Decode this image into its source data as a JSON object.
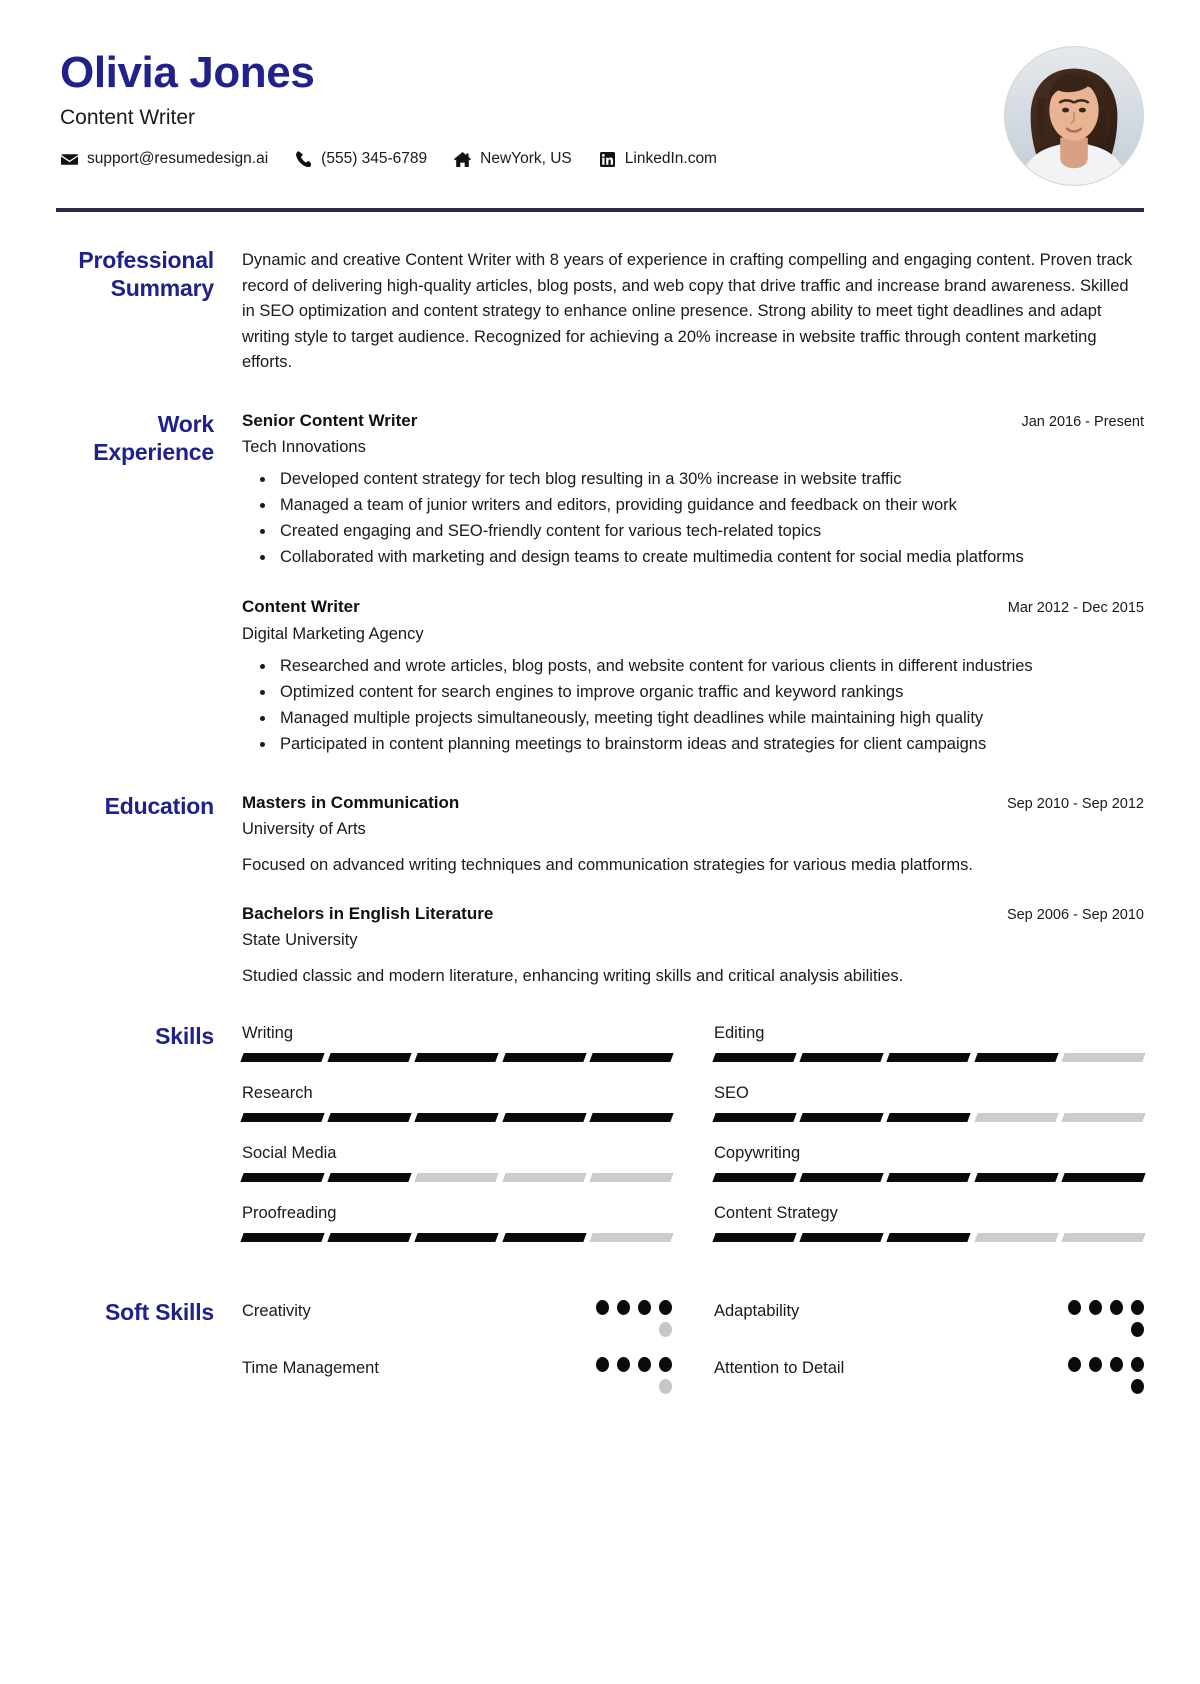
{
  "theme": {
    "accent": "#21218c",
    "rule": "#2b2b44",
    "bar_filled": "#0b0b0b",
    "bar_empty": "#cccccc",
    "dot_filled": "#0b0b0b",
    "dot_empty": "#c6c6c6"
  },
  "header": {
    "name": "Olivia Jones",
    "job_title": "Content Writer",
    "contacts": [
      {
        "icon": "envelope-icon",
        "text": "support@resumedesign.ai"
      },
      {
        "icon": "phone-icon",
        "text": "(555) 345-6789"
      },
      {
        "icon": "home-icon",
        "text": "NewYork, US"
      },
      {
        "icon": "linkedin-icon",
        "text": "LinkedIn.com"
      }
    ],
    "avatar_alt": "profile photo"
  },
  "sections": {
    "summary": {
      "label": "Professional Summary",
      "text": "Dynamic and creative Content Writer with 8 years of experience in crafting compelling and engaging content. Proven track record of delivering high-quality articles, blog posts, and web copy that drive traffic and increase brand awareness. Skilled in SEO optimization and content strategy to enhance online presence. Strong ability to meet tight deadlines and adapt writing style to target audience. Recognized for achieving a 20% increase in website traffic through content marketing efforts."
    },
    "work": {
      "label": "Work Experience",
      "entries": [
        {
          "title": "Senior Content Writer",
          "date": "Jan 2016 - Present",
          "org": "Tech Innovations",
          "bullets": [
            "Developed content strategy for tech blog resulting in a 30% increase in website traffic",
            "Managed a team of junior writers and editors, providing guidance and feedback on their work",
            "Created engaging and SEO-friendly content for various tech-related topics",
            "Collaborated with marketing and design teams to create multimedia content for social media platforms"
          ]
        },
        {
          "title": "Content Writer",
          "date": "Mar 2012 - Dec 2015",
          "org": "Digital Marketing Agency",
          "bullets": [
            "Researched and wrote articles, blog posts, and website content for various clients in different industries",
            "Optimized content for search engines to improve organic traffic and keyword rankings",
            "Managed multiple projects simultaneously, meeting tight deadlines while maintaining high quality",
            "Participated in content planning meetings to brainstorm ideas and strategies for client campaigns"
          ]
        }
      ]
    },
    "education": {
      "label": "Education",
      "entries": [
        {
          "title": "Masters in Communication",
          "date": "Sep 2010 - Sep 2012",
          "org": "University of Arts",
          "desc": "Focused on advanced writing techniques and communication strategies for various media platforms."
        },
        {
          "title": "Bachelors in English Literature",
          "date": "Sep 2006 - Sep 2010",
          "org": "State University",
          "desc": "Studied classic and modern literature, enhancing writing skills and critical analysis abilities."
        }
      ]
    },
    "skills": {
      "label": "Skills",
      "max": 5,
      "items": [
        {
          "name": "Writing",
          "level": 5
        },
        {
          "name": "Editing",
          "level": 4
        },
        {
          "name": "Research",
          "level": 5
        },
        {
          "name": "SEO",
          "level": 3
        },
        {
          "name": "Social Media",
          "level": 2
        },
        {
          "name": "Copywriting",
          "level": 5
        },
        {
          "name": "Proofreading",
          "level": 4
        },
        {
          "name": "Content Strategy",
          "level": 3
        }
      ]
    },
    "soft_skills": {
      "label": "Soft Skills",
      "max": 5,
      "items": [
        {
          "name": "Creativity",
          "level": 4
        },
        {
          "name": "Adaptability",
          "level": 5
        },
        {
          "name": "Time Management",
          "level": 4
        },
        {
          "name": "Attention to Detail",
          "level": 5
        }
      ]
    }
  }
}
